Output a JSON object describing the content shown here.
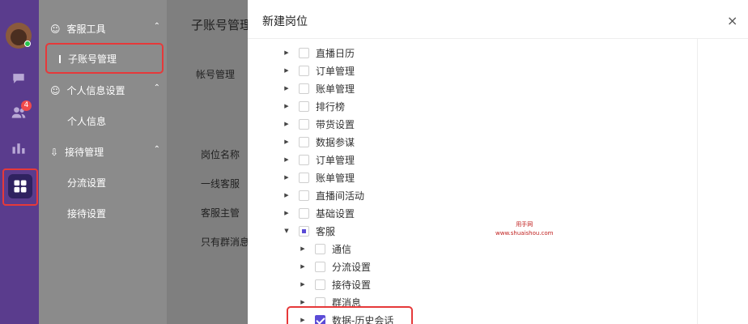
{
  "subnav": {
    "group1": "客服工具",
    "item_active": "子账号管理",
    "group2": "个人信息设置",
    "item2": "个人信息",
    "group3": "接待管理",
    "item3a": "分流设置",
    "item3b": "接待设置"
  },
  "rail": {
    "badge": "4"
  },
  "main": {
    "title": "子账号管理",
    "tab": "帐号管理",
    "col": "岗位名称",
    "row1": "一线客服",
    "row2": "客服主管",
    "row3": "只有群消息"
  },
  "drawer": {
    "title": "新建岗位",
    "close": "×",
    "tree": [
      {
        "label": "直播日历",
        "level": 0,
        "state": "none"
      },
      {
        "label": "订单管理",
        "level": 0,
        "state": "none"
      },
      {
        "label": "账单管理",
        "level": 0,
        "state": "none"
      },
      {
        "label": "排行榜",
        "level": 0,
        "state": "none"
      },
      {
        "label": "带货设置",
        "level": 0,
        "state": "none"
      },
      {
        "label": "数据参谋",
        "level": 0,
        "state": "none"
      },
      {
        "label": "订单管理",
        "level": 0,
        "state": "none"
      },
      {
        "label": "账单管理",
        "level": 0,
        "state": "none"
      },
      {
        "label": "直播间活动",
        "level": 0,
        "state": "none"
      },
      {
        "label": "基础设置",
        "level": 0,
        "state": "none"
      },
      {
        "label": "客服",
        "level": 0,
        "state": "half"
      },
      {
        "label": "通信",
        "level": 1,
        "state": "none"
      },
      {
        "label": "分流设置",
        "level": 1,
        "state": "none"
      },
      {
        "label": "接待设置",
        "level": 1,
        "state": "none"
      },
      {
        "label": "群消息",
        "level": 1,
        "state": "none"
      },
      {
        "label": "数据-历史会话",
        "level": 1,
        "state": "checked"
      }
    ]
  },
  "watermark": {
    "line1": "用手网",
    "line2": "www.shuaishou.com"
  }
}
